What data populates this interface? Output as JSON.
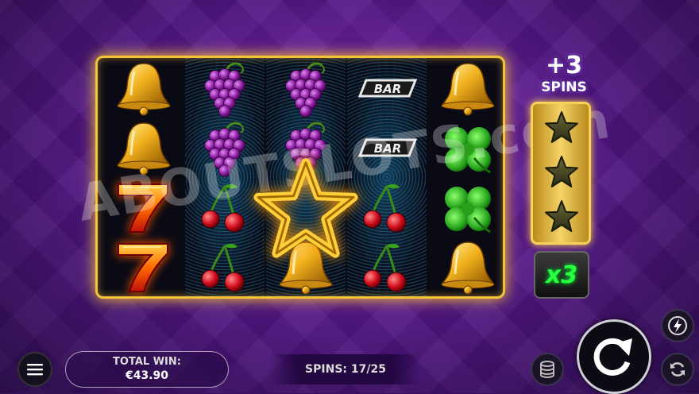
{
  "watermark": "ABOUTSLOTS.com",
  "reels": [
    [
      "bell",
      "bell",
      "seven",
      "seven"
    ],
    [
      "grapes",
      "grapes",
      "cherries",
      "cherries"
    ],
    [
      "grapes",
      "grapes",
      "star",
      "bell"
    ],
    [
      "bar",
      "bar",
      "cherries",
      "cherries"
    ],
    [
      "bell",
      "clover",
      "clover",
      "bell"
    ]
  ],
  "bar_label": "BAR",
  "bonus": {
    "plus": "+3",
    "spins_label": "SPINS",
    "stars_collected": 3,
    "stars_total": 3
  },
  "multiplier": "x3",
  "total_win": {
    "label": "TOTAL WIN:",
    "value": "€43.90"
  },
  "spins_counter": "SPINS: 17/25",
  "icons": {
    "menu": "hamburger-menu-icon",
    "stake": "coin-stack-icon",
    "spin": "spin-arrow-icon",
    "turbo": "lightning-icon",
    "autoplay": "autoplay-arrows-icon"
  },
  "colors": {
    "frame_gold": "#f4c23a",
    "multiplier_green": "#2aff40",
    "background_purple": "#4a157a"
  }
}
